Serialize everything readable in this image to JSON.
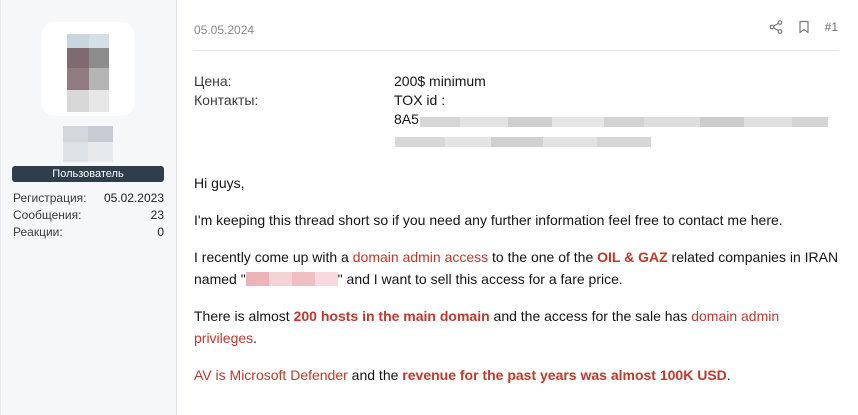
{
  "user": {
    "role_badge": "Пользователь",
    "stats": [
      {
        "key": "Регистрация:",
        "value": "05.02.2023"
      },
      {
        "key": "Сообщения:",
        "value": "23"
      },
      {
        "key": "Реакции:",
        "value": "0"
      }
    ]
  },
  "post": {
    "date": "05.05.2024",
    "number": "#1",
    "icons": {
      "share": "share-icon",
      "bookmark": "bookmark-icon"
    },
    "fields": [
      {
        "label": "Цена:",
        "value": "200$ minimum"
      },
      {
        "label": "Контакты:",
        "value": "TOX id :"
      }
    ],
    "tox_prefix": "8A5",
    "body": {
      "p1": "Hi guys,",
      "p2": "I'm keeping this thread short so if you need any further information feel free to contact me here.",
      "p3": {
        "t1": "I recently come up with a ",
        "h1": "domain admin access",
        "t2": " to the one of the ",
        "h2": "OIL & GAZ",
        "t3": " related companies in IRAN named \"",
        "t4": "\" and I want to sell this access for a fare price."
      },
      "p4": {
        "t1": "There is almost ",
        "h1": "200 hosts in the main domain",
        "t2": " and the access for the sale has ",
        "h2": "domain admin privileges",
        "t3": "."
      },
      "p5": {
        "h1": "AV is Microsoft Defender",
        "t1": " and the ",
        "h2": "revenue for the past years was almost 100K USD",
        "t2": "."
      }
    }
  },
  "colors": {
    "accent": "#c0392b",
    "badge": "#2f3e4c",
    "sidebar": "#f5f7f9"
  }
}
